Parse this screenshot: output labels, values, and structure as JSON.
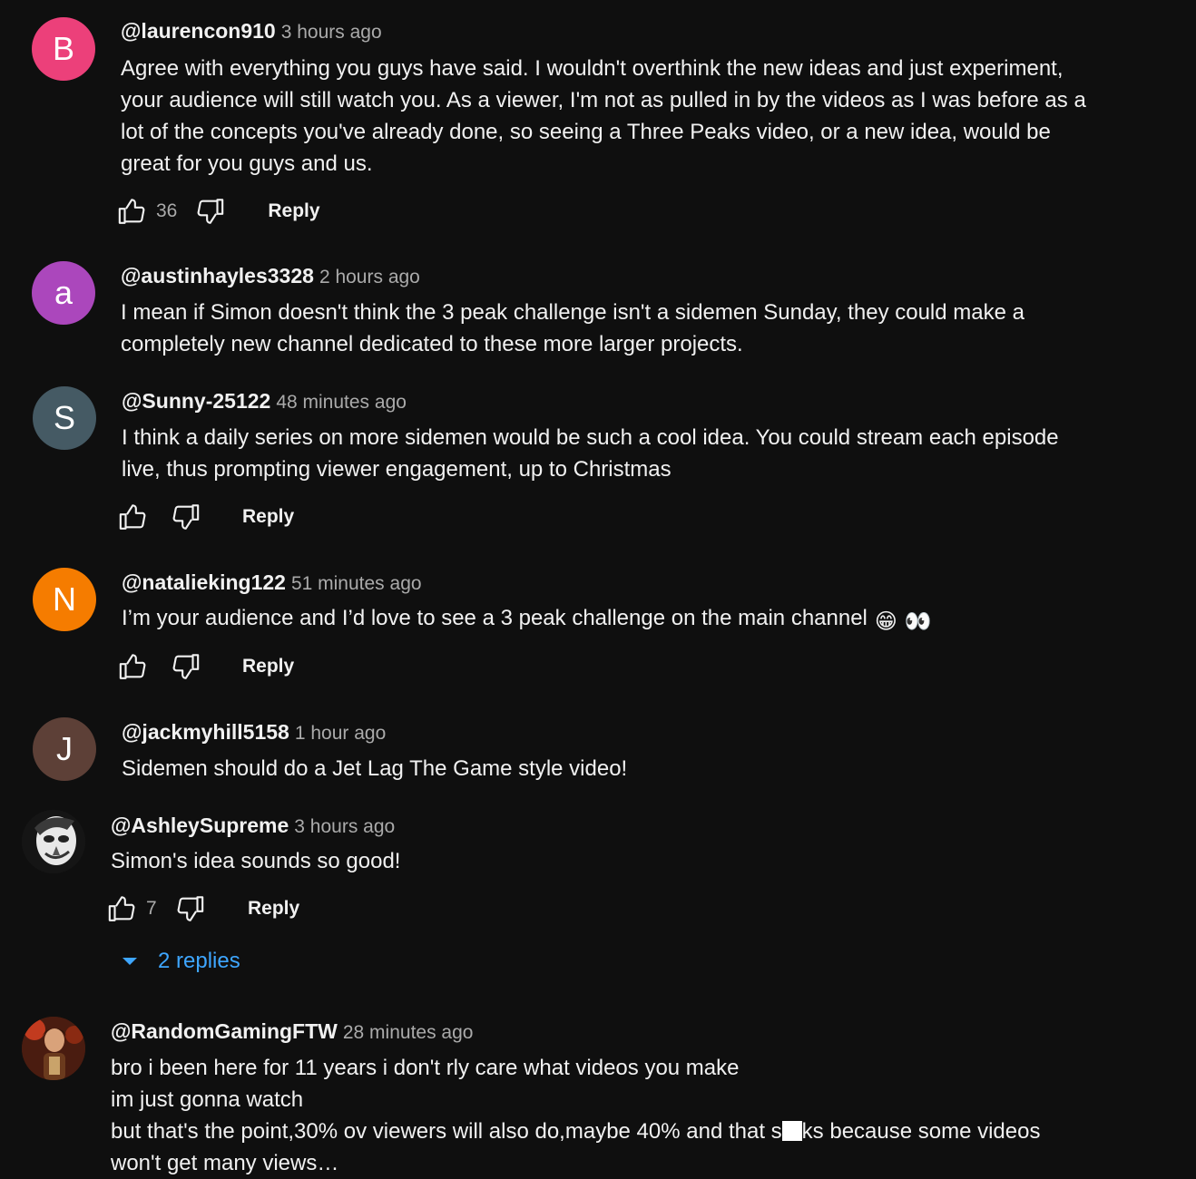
{
  "colors": {
    "background": "#0f0f0f",
    "text": "#f1f1f1",
    "secondary_text": "#aaaaaa",
    "link": "#3ea6ff"
  },
  "icons": {
    "like": "thumbs-up-icon",
    "dislike": "thumbs-down-icon",
    "expand": "caret-down-icon"
  },
  "comments": [
    {
      "avatar_letter": "B",
      "avatar_color": "#ec407a",
      "author": "@laurencon910",
      "time": "3 hours ago",
      "lines": [
        "Agree with everything you guys have said. I wouldn't overthink the new ideas and just experiment,",
        "your audience will still watch you. As a viewer, I'm not as pulled in by the videos as I was before as a",
        "lot of the concepts you've already done, so seeing a Three Peaks video, or a new idea, would be",
        "great for you guys and us."
      ],
      "likes": "36",
      "reply_label": "Reply"
    },
    {
      "avatar_letter": "a",
      "avatar_color": "#ab47bc",
      "author": "@austinhayles3328",
      "time": "2 hours ago",
      "lines": [
        "I mean if Simon doesn't think the 3 peak challenge isn't a sidemen Sunday, they could make a",
        "completely new channel dedicated to these more larger projects."
      ]
    },
    {
      "avatar_letter": "S",
      "avatar_color": "#455a64",
      "author": "@Sunny-25122",
      "time": "48 minutes ago",
      "lines": [
        "I think a daily series on more sidemen would be such a cool idea. You could stream each episode",
        "live, thus prompting viewer engagement, up to Christmas"
      ],
      "likes": "",
      "reply_label": "Reply"
    },
    {
      "avatar_letter": "N",
      "avatar_color": "#f57c00",
      "author": "@natalieking122",
      "time": "51 minutes ago",
      "lines": [
        "I’m your audience and I’d love to see a 3 peak challenge on the main channel"
      ],
      "emojis": [
        "😁",
        "👀"
      ],
      "likes": "",
      "reply_label": "Reply"
    },
    {
      "avatar_letter": "J",
      "avatar_color": "#5d4037",
      "author": "@jackmyhill5158",
      "time": "1 hour ago",
      "lines": [
        "Sidemen should do a Jet Lag The Game  style video!"
      ]
    },
    {
      "avatar_letter": "",
      "author": "@AshleySupreme",
      "time": "3 hours ago",
      "lines": [
        "Simon's idea sounds so good!"
      ],
      "likes": "7",
      "reply_label": "Reply",
      "replies_label": "2 replies"
    },
    {
      "avatar_letter": "",
      "author": "@RandomGamingFTW",
      "time": "28 minutes ago",
      "lines": [
        "bro i been here for 11 years i don't rly care what videos you make",
        "im just gonna watch"
      ],
      "line3_before": "but that's the point,30% ov viewers will also do,maybe 40% and that s",
      "line3_after": "ks because some videos",
      "line4": "won't get many views…"
    }
  ]
}
